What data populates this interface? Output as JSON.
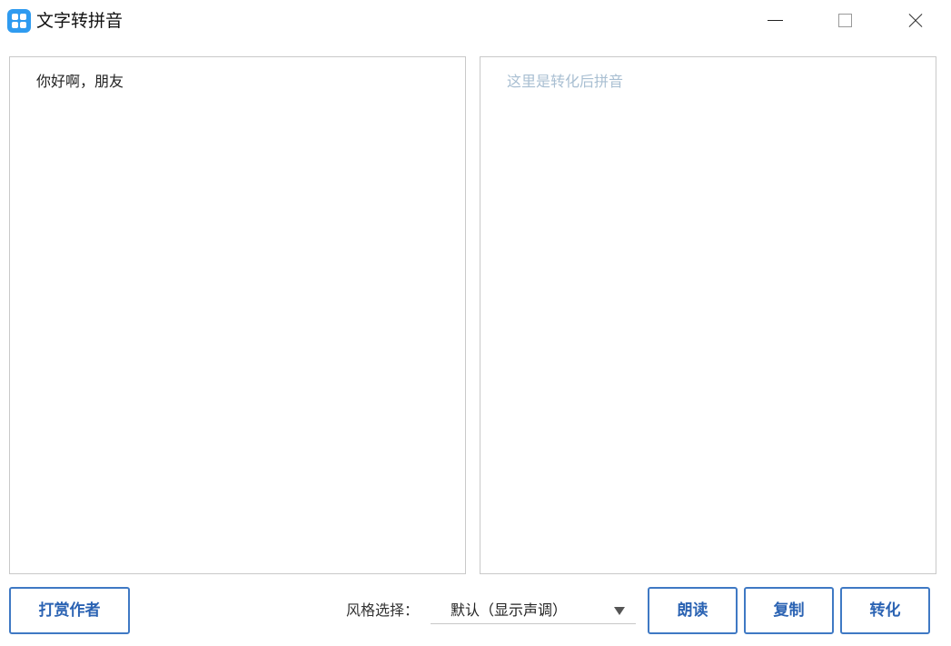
{
  "window": {
    "title": "文字转拼音"
  },
  "input": {
    "value": "你好啊，朋友"
  },
  "output": {
    "placeholder": "这里是转化后拼音"
  },
  "toolbar": {
    "reward_label": "打赏作者",
    "style_label": "风格选择：",
    "style_selected": "默认（显示声调）",
    "read_label": "朗读",
    "copy_label": "复制",
    "convert_label": "转化"
  },
  "colors": {
    "accent": "#2b63b3",
    "button_border": "#3f79c4",
    "app_icon": "#2f9bf0",
    "placeholder": "#a9bfd2"
  },
  "icons": {
    "app": "app-grid-icon",
    "minimize": "minimize-icon",
    "maximize": "maximize-icon",
    "close": "close-icon",
    "dropdown": "chevron-down-icon"
  }
}
